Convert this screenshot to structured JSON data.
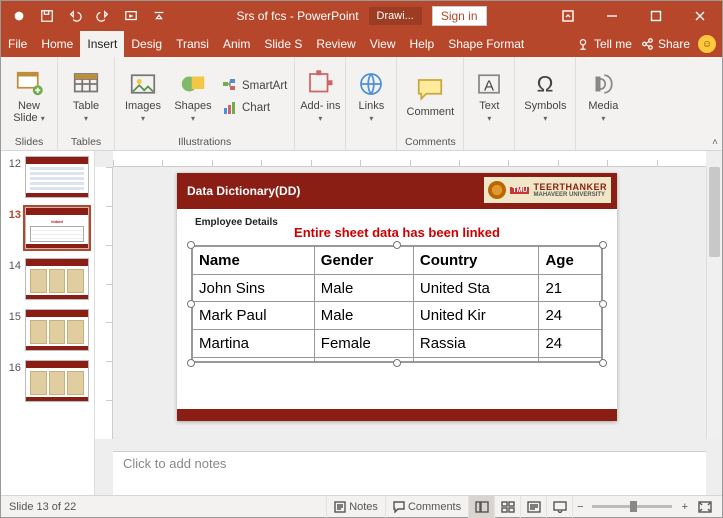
{
  "qat": {
    "autosave": "●"
  },
  "title": {
    "doc": "Srs of fcs",
    "app": "PowerPoint",
    "context_tab": "Drawi..."
  },
  "signin": "Sign in",
  "tabs": {
    "file": "File",
    "home": "Home",
    "insert": "Insert",
    "design": "Desig",
    "transitions": "Transi",
    "animations": "Anim",
    "slideshow": "Slide S",
    "review": "Review",
    "view": "View",
    "help": "Help",
    "shapefmt": "Shape Format",
    "tellme": "Tell me",
    "share": "Share"
  },
  "ribbon": {
    "newslide": "New\nSlide",
    "slides_group": "Slides",
    "table": "Table",
    "tables_group": "Tables",
    "images": "Images",
    "shapes": "Shapes",
    "smartart": "SmartArt",
    "chart": "Chart",
    "illustrations_group": "Illustrations",
    "addins": "Add-\nins",
    "links": "Links",
    "comment": "Comment",
    "comments_group": "Comments",
    "text": "Text",
    "symbols": "Symbols",
    "media": "Media"
  },
  "thumbs": {
    "n12": "12",
    "n13": "13",
    "n14": "14",
    "n15": "15",
    "n16": "16"
  },
  "slide": {
    "header": "Data Dictionary(DD)",
    "uni1": "TEERTHANKER",
    "uni2": "MAHAVEER UNIVERSITY",
    "tmu": "TMU",
    "emp": "Employee Details",
    "msg": "Entire sheet data has been linked",
    "headers": {
      "c1": "Name",
      "c2": "Gender",
      "c3": "Country",
      "c4": "Age"
    },
    "rows": [
      {
        "c1": "John Sins",
        "c2": "Male",
        "c3": "United Sta",
        "c4": "21"
      },
      {
        "c1": "Mark Paul",
        "c2": "Male",
        "c3": "United Kir",
        "c4": "24"
      },
      {
        "c1": "Martina",
        "c2": "Female",
        "c3": "Rassia",
        "c4": "24"
      }
    ]
  },
  "notes_placeholder": "Click to add notes",
  "status": {
    "slide_of": "Slide 13 of 22",
    "notes": "Notes",
    "comments": "Comments",
    "zoom_pct": "+"
  }
}
